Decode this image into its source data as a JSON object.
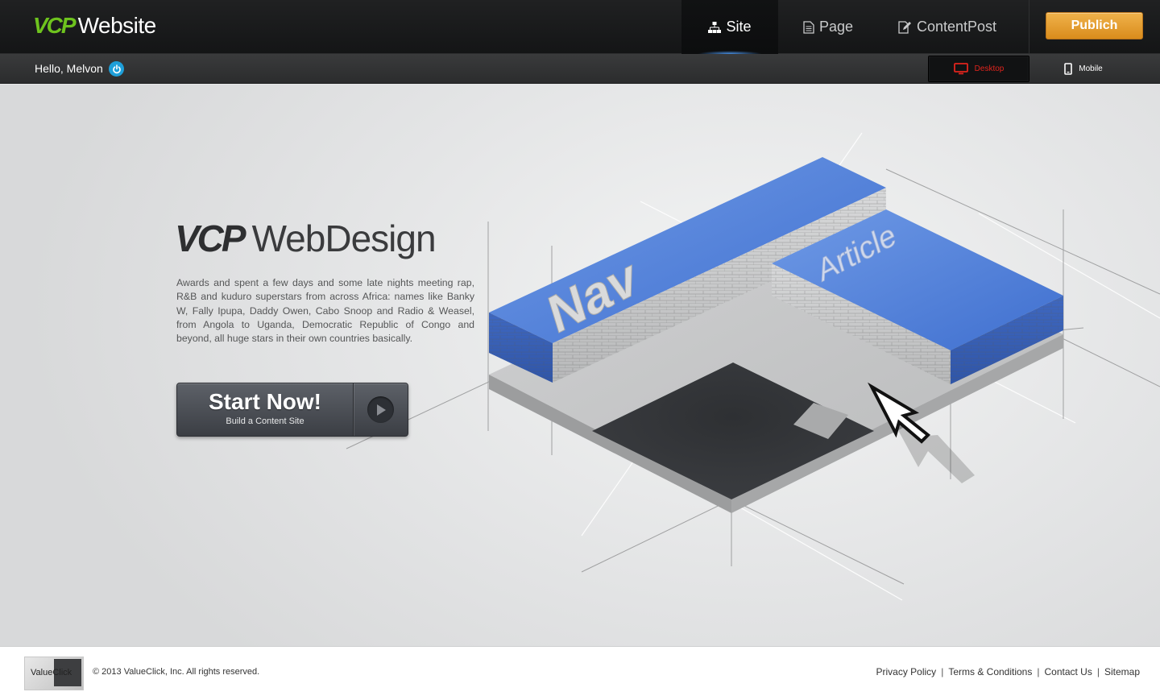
{
  "header": {
    "logo_brand": "VCP",
    "logo_text": "Website",
    "tabs": [
      {
        "label": "Site",
        "icon": "sitemap-icon",
        "active": true
      },
      {
        "label": "Page",
        "icon": "page-icon",
        "active": false
      },
      {
        "label": "ContentPost",
        "icon": "edit-post-icon",
        "active": false
      }
    ],
    "publish_label": "Publich"
  },
  "subbar": {
    "greeting": "Hello, Melvon",
    "devices": [
      {
        "label": "Desktop",
        "active": true
      },
      {
        "label": "Mobile",
        "active": false
      }
    ]
  },
  "hero": {
    "title_brand": "VCP",
    "title_text": "WebDesign",
    "body": "Awards and spent a few days and some late nights meeting rap, R&B and kuduro superstars from across Africa: names like Banky W, Fally Ipupa, Daddy Owen, Cabo Snoop and Radio & Weasel, from Angola to Uganda, Democratic Republic of Congo and beyond, all huge stars in their own countries basically.",
    "cta_label": "Start Now!",
    "cta_sub": "Build a Content Site",
    "illustration_labels": {
      "nav": "Nav",
      "article": "Article"
    }
  },
  "footer": {
    "logo_text": "ValueClick",
    "copyright": "© 2013 ValueClick, Inc. All rights reserved.",
    "links": [
      "Privacy Policy",
      "Terms & Conditions",
      "Contact Us",
      "Sitemap"
    ]
  },
  "colors": {
    "brand_green": "#6ec31e",
    "publish_orange": "#e39f2f",
    "active_device_red": "#e0241d",
    "block_blue": "#4f7fd8",
    "power_blue": "#1e9fd9"
  }
}
